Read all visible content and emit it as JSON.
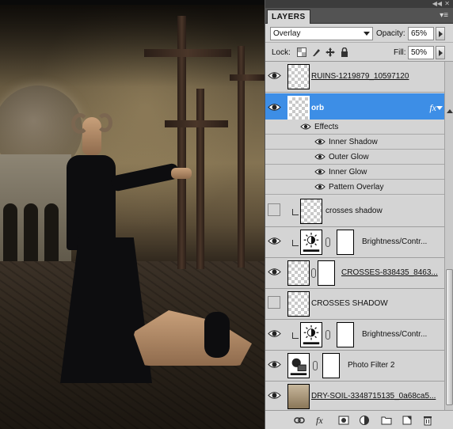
{
  "panel": {
    "tab_label": "LAYERS",
    "menu_icon": "panel-menu-icon",
    "blend_mode": "Overlay",
    "opacity_label": "Opacity:",
    "opacity_value": "65%",
    "lock_label": "Lock:",
    "fill_label": "Fill:",
    "fill_value": "50%"
  },
  "layers": [
    {
      "name": "RUINS-1219879_10597120",
      "visible": true,
      "type": "smart",
      "style": "underline"
    },
    {
      "name": "orb",
      "visible": true,
      "type": "pixel",
      "selected": true,
      "fx": "fx",
      "style": "bold"
    },
    {
      "name": "crosses shadow",
      "visible": false,
      "type": "pixel",
      "clipped": true
    },
    {
      "name": "Brightness/Contr...",
      "visible": true,
      "type": "adjustment",
      "icon": "brightness-contrast-icon",
      "clipped": true
    },
    {
      "name": "CROSSES-838435_8463...",
      "visible": true,
      "type": "smart",
      "style": "underline"
    },
    {
      "name": "CROSSES SHADOW",
      "visible": false,
      "type": "pixel"
    },
    {
      "name": "Brightness/Contr...",
      "visible": true,
      "type": "adjustment",
      "icon": "brightness-contrast-icon",
      "clipped": true
    },
    {
      "name": "Photo Filter 2",
      "visible": true,
      "type": "adjustment",
      "icon": "photo-filter-icon"
    },
    {
      "name": "DRY-SOIL-3348715135_0a68ca5...",
      "visible": true,
      "type": "smart",
      "style": "underline"
    }
  ],
  "effects": {
    "label": "Effects",
    "items": [
      "Inner Shadow",
      "Outer Glow",
      "Inner Glow",
      "Pattern Overlay"
    ]
  },
  "bottom_icons": [
    "link-layers-icon",
    "layer-style-icon",
    "add-mask-icon",
    "adjustment-layer-icon",
    "new-group-icon",
    "new-layer-icon",
    "trash-icon"
  ],
  "bottom_fx_label": "fx",
  "colors": {
    "selected": "#3d8ee6",
    "panel_bg": "#d6d6d6"
  }
}
